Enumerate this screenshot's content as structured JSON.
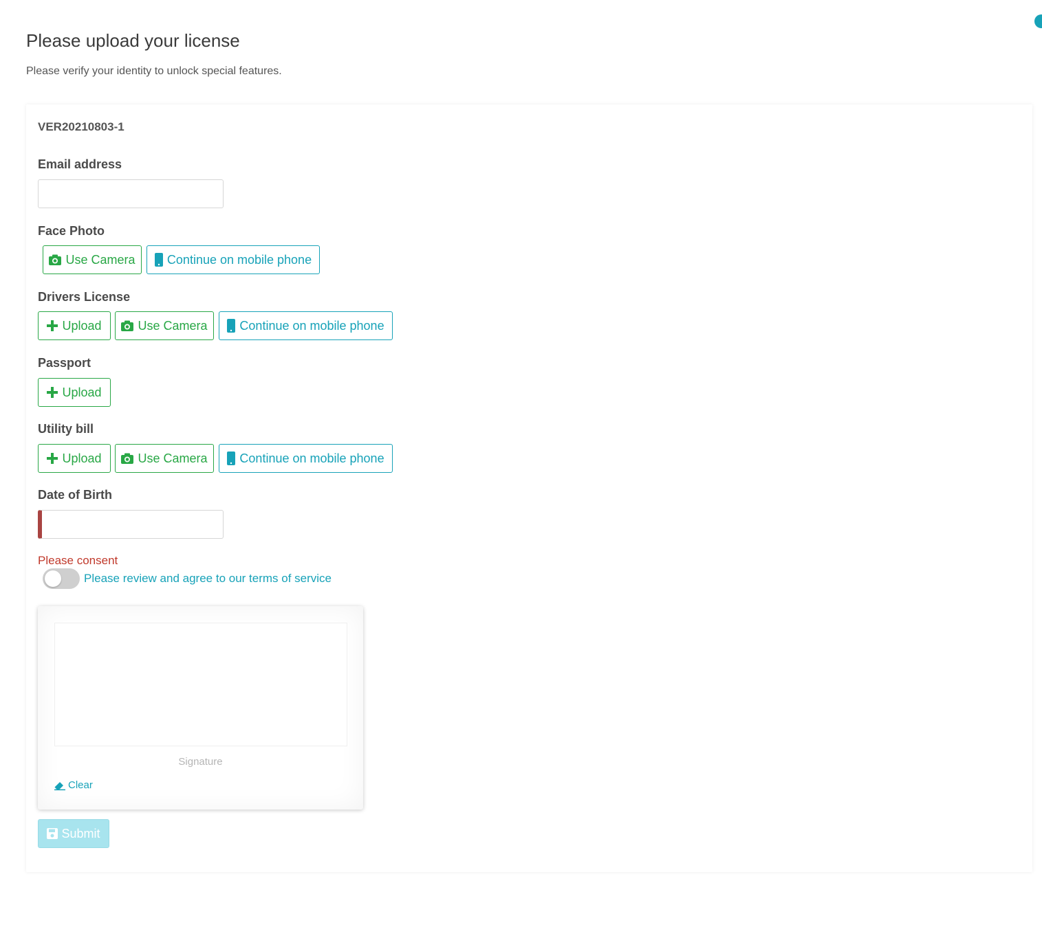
{
  "header": {
    "title": "Please upload your license",
    "subtitle": "Please verify your identity to unlock special features."
  },
  "form": {
    "reference_id": "VER20210803-1",
    "email": {
      "label": "Email address",
      "value": "",
      "placeholder": ""
    },
    "face_photo": {
      "label": "Face Photo",
      "use_camera_label": "Use Camera",
      "mobile_label": "Continue on mobile phone"
    },
    "drivers_license": {
      "label": "Drivers License",
      "upload_label": "Upload",
      "use_camera_label": "Use Camera",
      "mobile_label": "Continue on mobile phone"
    },
    "passport": {
      "label": "Passport",
      "upload_label": "Upload"
    },
    "utility_bill": {
      "label": "Utility bill",
      "upload_label": "Upload",
      "use_camera_label": "Use Camera",
      "mobile_label": "Continue on mobile phone"
    },
    "date_of_birth": {
      "label": "Date of Birth",
      "value": ""
    },
    "consent": {
      "error": "Please consent",
      "toggle_on": false,
      "terms_label": "Please review and agree to our terms of service"
    },
    "signature": {
      "caption": "Signature",
      "clear_label": "Clear"
    },
    "submit_label": "Submit"
  },
  "colors": {
    "green": "#28a745",
    "teal": "#17a2b8",
    "error": "#c0392b",
    "submit_disabled": "#a8e4ee"
  },
  "icons": {
    "camera": "camera-icon",
    "mobile": "mobile-phone-icon",
    "upload": "plus-icon",
    "eraser": "eraser-icon",
    "save": "save-icon",
    "help": "help-icon"
  }
}
